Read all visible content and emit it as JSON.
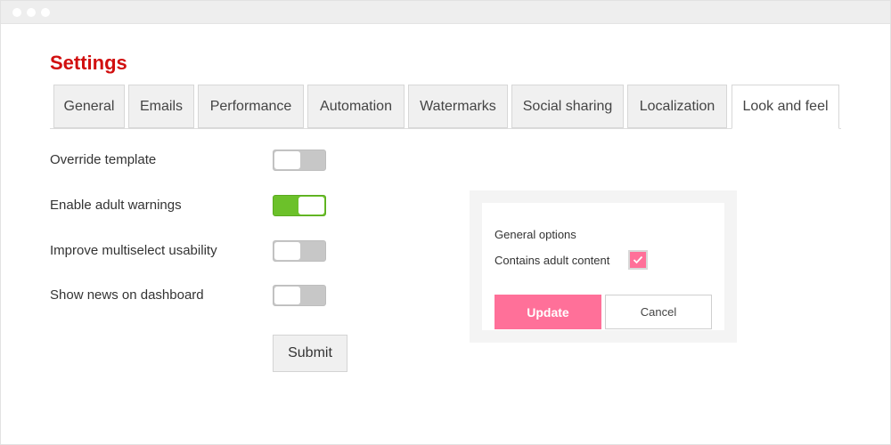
{
  "page": {
    "title": "Settings"
  },
  "tabs": [
    {
      "label": "General"
    },
    {
      "label": "Emails"
    },
    {
      "label": "Performance"
    },
    {
      "label": "Automation"
    },
    {
      "label": "Watermarks"
    },
    {
      "label": "Social sharing"
    },
    {
      "label": "Localization"
    },
    {
      "label": "Look and feel",
      "active": true
    }
  ],
  "settings": [
    {
      "label": "Override template",
      "enabled": false
    },
    {
      "label": "Enable adult warnings",
      "enabled": true
    },
    {
      "label": "Improve multiselect usability",
      "enabled": false
    },
    {
      "label": "Show news on dashboard",
      "enabled": false
    }
  ],
  "form": {
    "submit_label": "Submit"
  },
  "panel": {
    "heading": "General options",
    "checkbox_label": "Contains adult content",
    "checkbox_checked": true,
    "update_label": "Update",
    "cancel_label": "Cancel"
  },
  "colors": {
    "title": "#d10f0f",
    "toggle_on": "#6cc12a",
    "accent_pink": "#ff7099"
  }
}
